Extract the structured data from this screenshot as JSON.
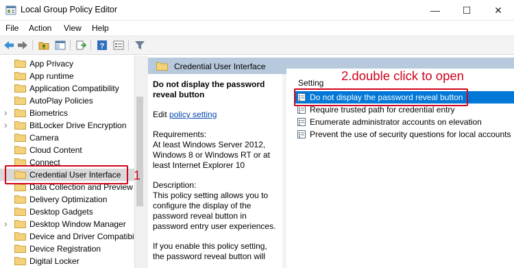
{
  "window": {
    "title": "Local Group Policy Editor",
    "minimize_glyph": "—",
    "maximize_glyph": "☐",
    "close_glyph": "✕"
  },
  "menu": [
    "File",
    "Action",
    "View",
    "Help"
  ],
  "toolbar": {
    "buttons": [
      "back-arrow-icon",
      "forward-arrow-icon",
      "up-folder-icon",
      "show-hide-tree-icon",
      "export-list-icon",
      "help-icon",
      "properties-icon",
      "filter-icon"
    ]
  },
  "tree": {
    "items": [
      {
        "label": "App Privacy",
        "expandable": false
      },
      {
        "label": "App runtime",
        "expandable": false
      },
      {
        "label": "Application Compatibility",
        "expandable": false
      },
      {
        "label": "AutoPlay Policies",
        "expandable": false
      },
      {
        "label": "Biometrics",
        "expandable": true
      },
      {
        "label": "BitLocker Drive Encryption",
        "expandable": true
      },
      {
        "label": "Camera",
        "expandable": false
      },
      {
        "label": "Cloud Content",
        "expandable": false
      },
      {
        "label": "Connect",
        "expandable": false
      },
      {
        "label": "Credential User Interface",
        "expandable": false,
        "selected": true
      },
      {
        "label": "Data Collection and Preview",
        "expandable": false
      },
      {
        "label": "Delivery Optimization",
        "expandable": false
      },
      {
        "label": "Desktop Gadgets",
        "expandable": false
      },
      {
        "label": "Desktop Window Manager",
        "expandable": true
      },
      {
        "label": "Device and Driver Compatibi",
        "expandable": false
      },
      {
        "label": "Device Registration",
        "expandable": false
      },
      {
        "label": "Digital Locker",
        "expandable": false
      }
    ]
  },
  "annotations": {
    "step1": "1",
    "step2": "2.double click to open"
  },
  "pane": {
    "header_title": "Credential User Interface",
    "description": {
      "title": "Do not display the password reveal button",
      "edit_prefix": "Edit ",
      "edit_link": "policy setting ",
      "requirements": "Requirements:\nAt least Windows Server 2012, Windows 8 or Windows RT or at least Internet Explorer 10",
      "description": "Description:\nThis policy setting allows you to configure the display of the password reveal button in password entry user experiences.",
      "extra": "If you enable this policy setting, the password reveal button will"
    },
    "settings_header": "Setting",
    "settings": [
      {
        "label": "Do not display the password reveal button",
        "selected": true
      },
      {
        "label": "Require trusted path for credential entry",
        "selected": false
      },
      {
        "label": "Enumerate administrator accounts on elevation",
        "selected": false
      },
      {
        "label": "Prevent the use of security questions for local accounts",
        "selected": false
      }
    ]
  },
  "colors": {
    "annotation_red": "#d0021b",
    "selection_blue": "#0078d7",
    "header_blue": "#b7c9dc",
    "folder_yellow": "#e8b84a"
  }
}
